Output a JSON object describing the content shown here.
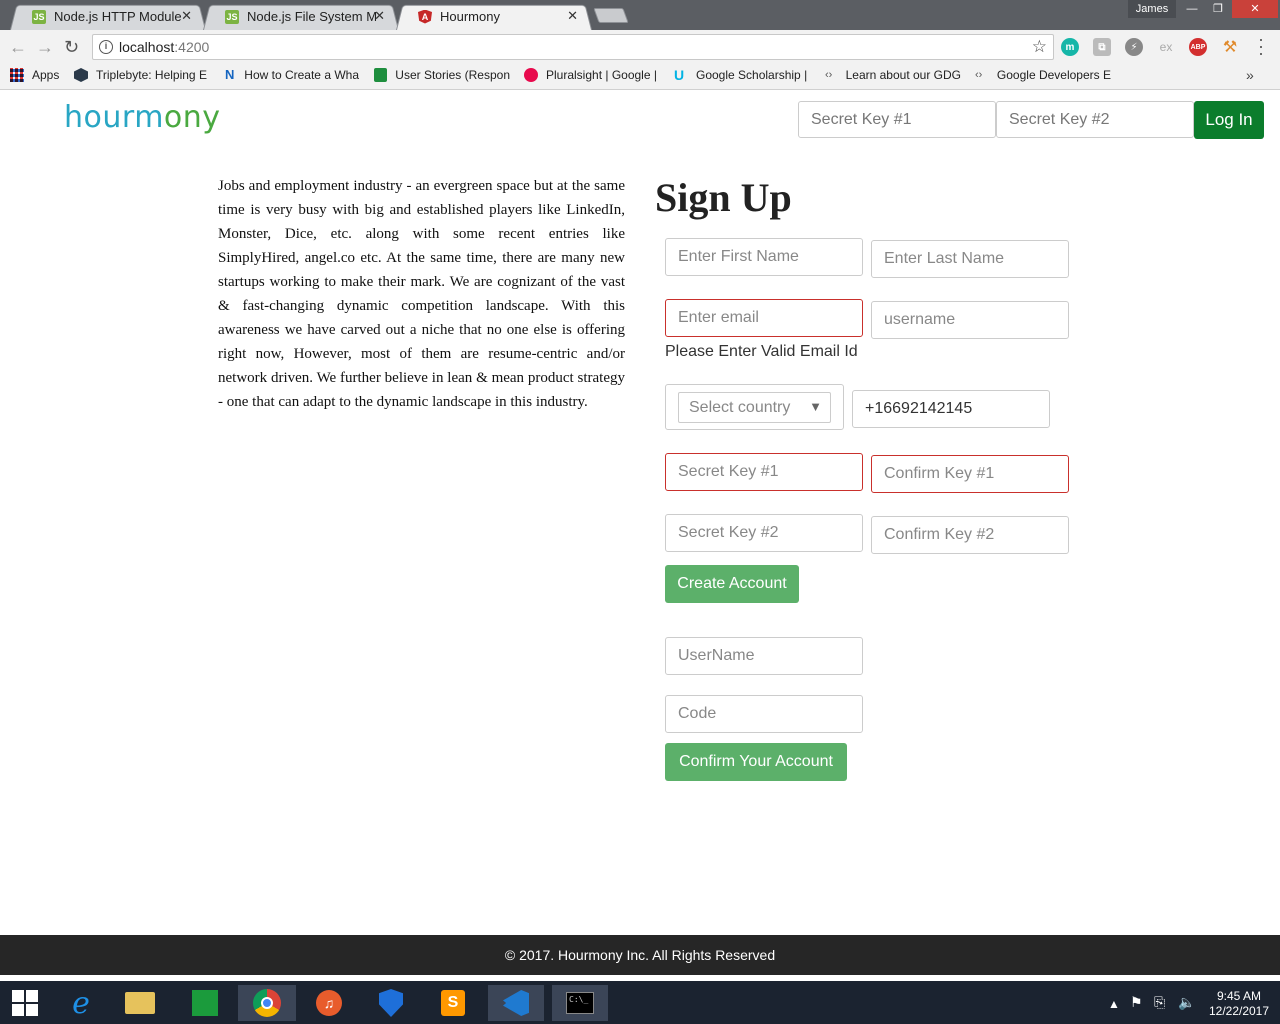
{
  "browser": {
    "tabs": [
      {
        "title": "Node.js HTTP Module",
        "icon": "node-icon"
      },
      {
        "title": "Node.js File System Mod",
        "icon": "node-icon"
      },
      {
        "title": "Hourmony",
        "icon": "angular-icon"
      }
    ],
    "user": "James",
    "url_host": "localhost",
    "url_port": ":4200",
    "bookmarks": [
      {
        "label": "Apps"
      },
      {
        "label": "Triplebyte: Helping E"
      },
      {
        "label": "How to Create a Wha"
      },
      {
        "label": "User Stories (Respon"
      },
      {
        "label": "Pluralsight | Google |"
      },
      {
        "label": "Google Scholarship |"
      },
      {
        "label": "Learn about our GDG"
      },
      {
        "label": "Google Developers E"
      }
    ]
  },
  "header": {
    "logo_part1": "hourm",
    "logo_part2": "ony",
    "secret_key_1_placeholder": "Secret Key #1",
    "secret_key_2_placeholder": "Secret Key #2",
    "login_label": "Log In"
  },
  "about_text": "Jobs and employment industry - an evergreen space but at the same time is very busy with big and established players like LinkedIn, Monster, Dice, etc. along with some recent entries like SimplyHired, angel.co etc. At the same time, there are many new startups working to make their mark. We are cognizant of the vast & fast-changing dynamic competition landscape. With this awareness we have carved out a niche that no one else is offering right now, However, most of them are resume-centric and/or network driven. We further believe in lean & mean product strategy - one that can adapt to the dynamic landscape in this industry.",
  "signup": {
    "title": "Sign Up",
    "first_name_placeholder": "Enter First Name",
    "last_name_placeholder": "Enter Last Name",
    "email_placeholder": "Enter email",
    "username_placeholder": "username",
    "email_error": "Please Enter Valid Email Id",
    "country_selected": "Select country",
    "phone_value": "+16692142145",
    "key1_placeholder": "Secret Key #1",
    "confirm_key1_placeholder": "Confirm Key #1",
    "key2_placeholder": "Secret Key #2",
    "confirm_key2_placeholder": "Confirm Key #2",
    "create_label": "Create Account"
  },
  "confirm": {
    "username_placeholder": "UserName",
    "code_placeholder": "Code",
    "confirm_label": "Confirm Your Account"
  },
  "footer": {
    "text": "© 2017. Hourmony Inc. All Rights Reserved"
  },
  "taskbar": {
    "time": "9:45 AM",
    "date": "12/22/2017"
  },
  "colors": {
    "brand_teal": "#29a6c4",
    "brand_green": "#4aa940",
    "login_green": "#0b7d2c",
    "button_green": "#5cb06a",
    "error_red": "#c9302c",
    "footer_bg": "#262626"
  }
}
